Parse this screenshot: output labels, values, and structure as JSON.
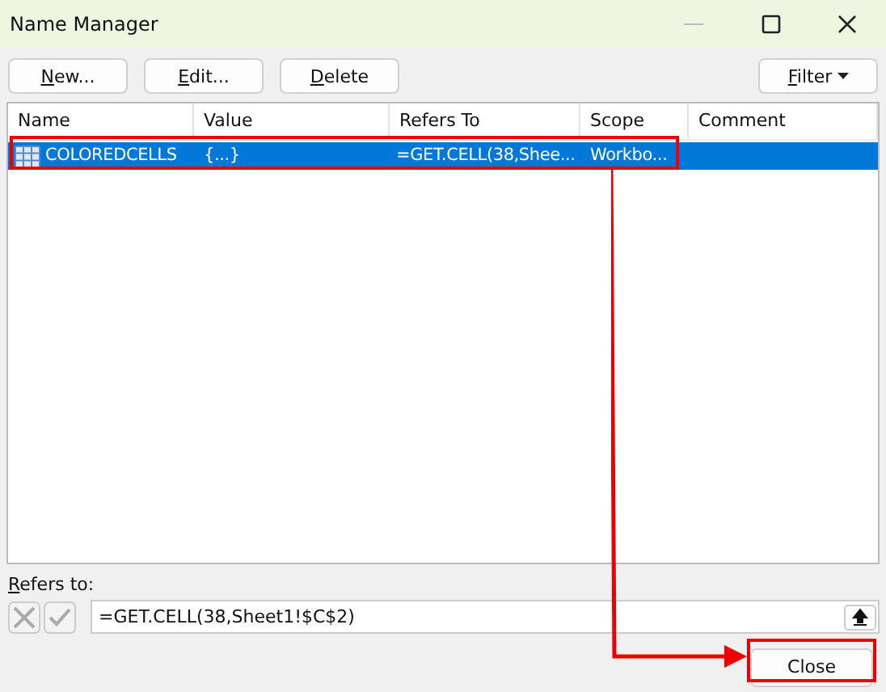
{
  "window": {
    "title": "Name Manager"
  },
  "toolbar": {
    "buttons": [
      "New...",
      "Edit...",
      "Delete"
    ],
    "filter": "Filter"
  },
  "table": {
    "columns": [
      "Name",
      "Value",
      "Refers To",
      "Scope",
      "Comment"
    ],
    "rows": [
      {
        "cells": [
          "COLOREDCELLS",
          "{...}",
          "=GET.CELL(38,Shee...",
          "Workbo...",
          ""
        ],
        "selected": true
      }
    ]
  },
  "refers_to": {
    "label": "Refers to:",
    "value": "=GET.CELL(38,Sheet1!$C$2)"
  },
  "close_button": "Close"
}
